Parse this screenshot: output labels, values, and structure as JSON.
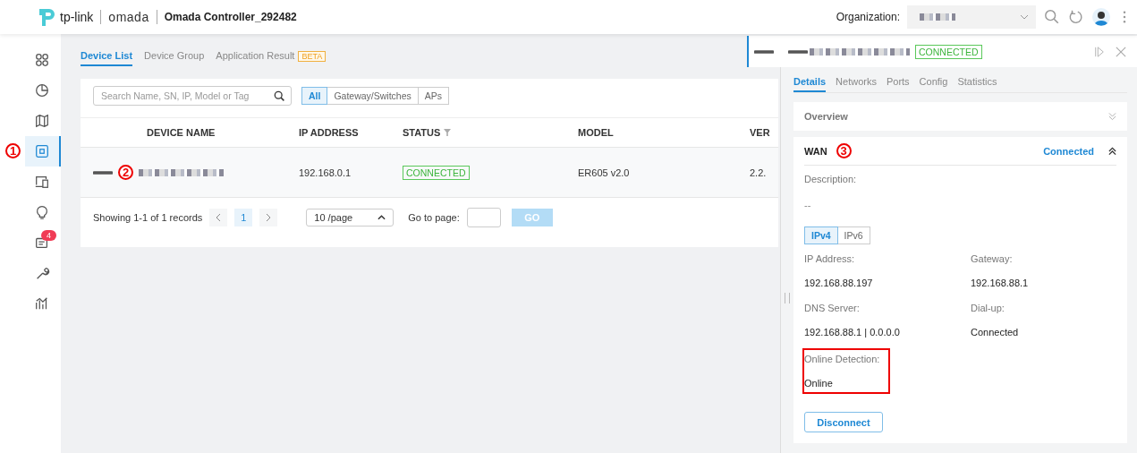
{
  "header": {
    "brand": "tp-link",
    "product": "omada",
    "title": "Omada Controller_292482",
    "organization_label": "Organization:"
  },
  "sidebar": {
    "items": [
      {
        "selected": false
      },
      {
        "selected": false
      },
      {
        "selected": false
      },
      {
        "selected": true,
        "callout": "1"
      },
      {
        "selected": false
      },
      {
        "selected": false
      },
      {
        "selected": false,
        "badge": "4"
      },
      {
        "selected": false
      },
      {
        "selected": false
      }
    ]
  },
  "tabs": [
    {
      "label": "Device List",
      "selected": true
    },
    {
      "label": "Device Group",
      "selected": false
    },
    {
      "label": "Application Result",
      "selected": false,
      "badge": "BETA"
    }
  ],
  "search": {
    "placeholder": "Search Name, SN, IP, Model or Tag"
  },
  "filters": [
    {
      "label": "All",
      "selected": true
    },
    {
      "label": "Gateway/Switches",
      "selected": false
    },
    {
      "label": "APs",
      "selected": false
    }
  ],
  "table": {
    "columns": [
      "DEVICE NAME",
      "IP ADDRESS",
      "STATUS",
      "MODEL",
      "VER"
    ],
    "rows": [
      {
        "callout": "2",
        "ip": "192.168.0.1",
        "status": "CONNECTED",
        "model": "ER605 v2.0",
        "version": "2.2."
      }
    ]
  },
  "pagination": {
    "summary": "Showing 1-1 of 1 records",
    "page": "1",
    "per_page": "10 /page",
    "goto_label": "Go to page:",
    "go": "GO"
  },
  "panel": {
    "status": "CONNECTED",
    "tabs": [
      {
        "label": "Details",
        "selected": true
      },
      {
        "label": "Networks",
        "selected": false
      },
      {
        "label": "Ports",
        "selected": false
      },
      {
        "label": "Config",
        "selected": false
      },
      {
        "label": "Statistics",
        "selected": false
      }
    ],
    "overview": {
      "title": "Overview",
      "expanded": false
    },
    "wan": {
      "title": "WAN",
      "callout": "3",
      "status": "Connected",
      "expanded": true,
      "description_label": "Description:",
      "description_value": "--",
      "ip_tabs": [
        {
          "label": "IPv4",
          "selected": true
        },
        {
          "label": "IPv6",
          "selected": false
        }
      ],
      "fields": [
        {
          "label": "IP Address:",
          "value": "192.168.88.197",
          "highlighted": false
        },
        {
          "label": "Gateway:",
          "value": "192.168.88.1",
          "highlighted": false
        },
        {
          "label": "DNS Server:",
          "value": "192.168.88.1 | 0.0.0.0",
          "highlighted": false
        },
        {
          "label": "Dial-up:",
          "value": "Connected",
          "highlighted": false
        },
        {
          "label": "Online Detection:",
          "value": "Online",
          "highlighted": true
        }
      ],
      "button": "Disconnect"
    }
  }
}
